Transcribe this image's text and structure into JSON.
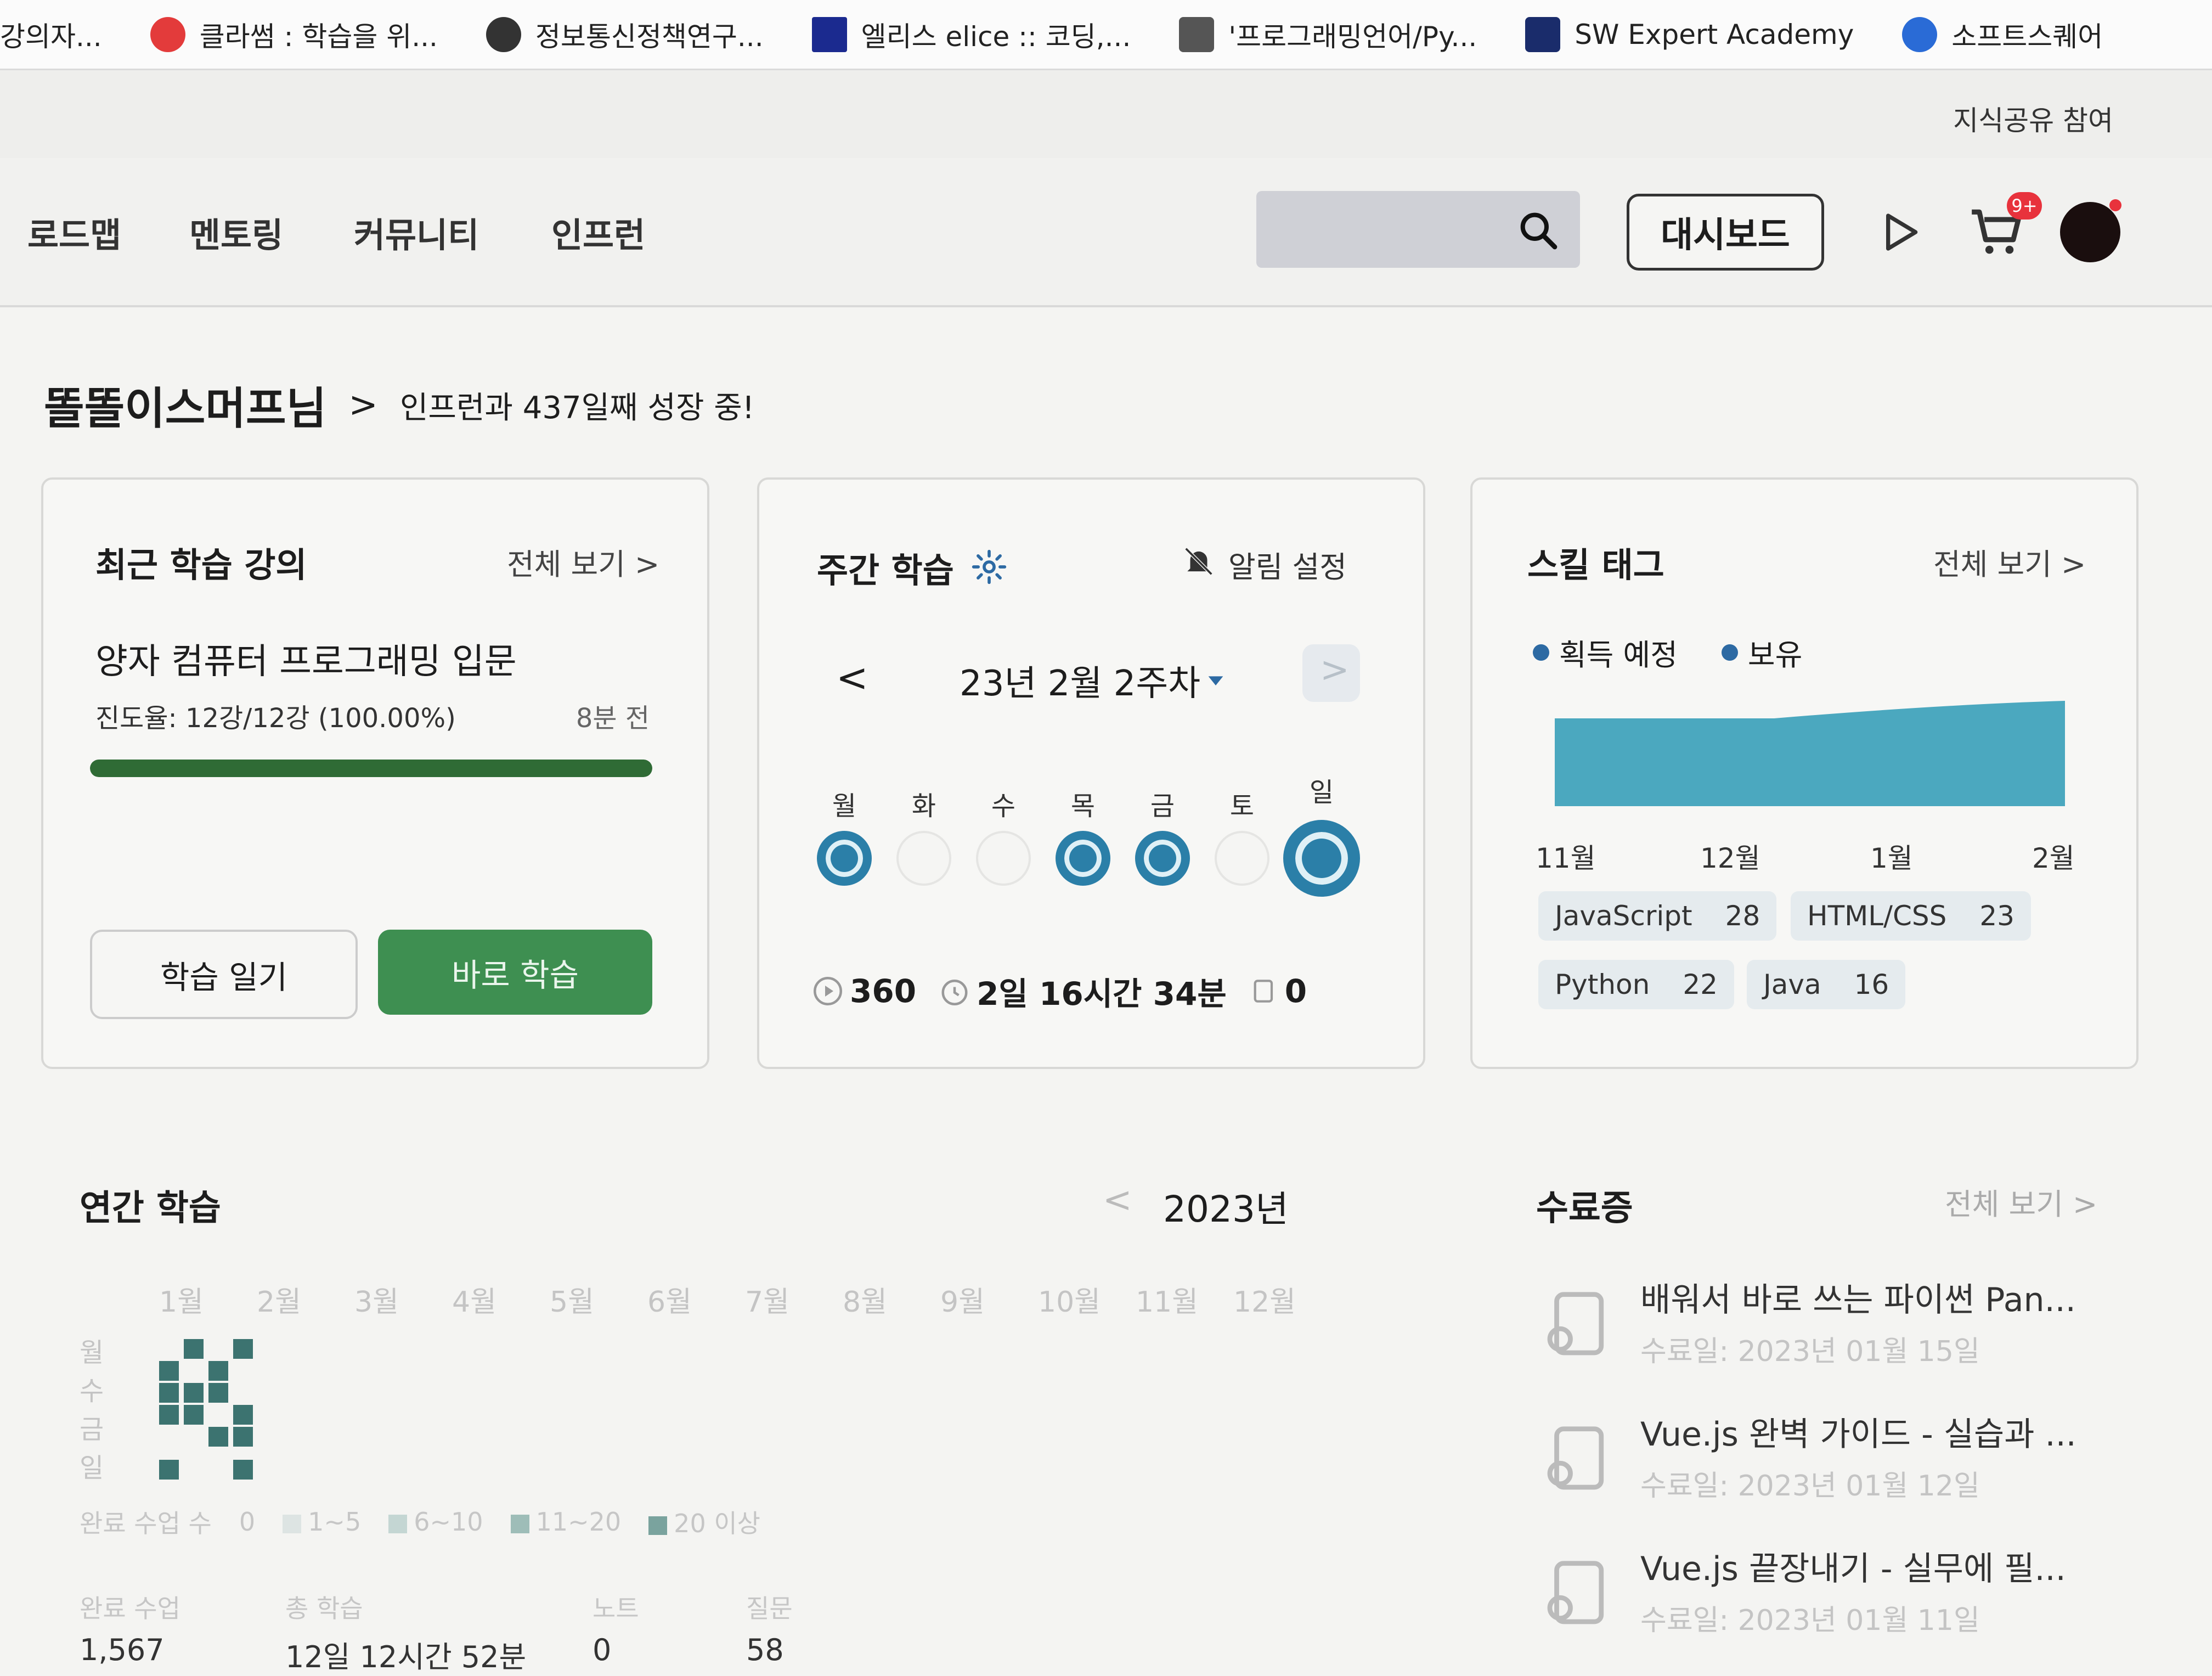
{
  "bookmarks": [
    {
      "label": "강의자...",
      "color": "#ffffff"
    },
    {
      "label": "클라썸 : 학습을 위...",
      "color": "#e33b3b"
    },
    {
      "label": "정보통신정책연구...",
      "color": "#333333"
    },
    {
      "label": "엘리스 elice :: 코딩,...",
      "color": "#1b2a8f"
    },
    {
      "label": "'프로그래밍언어/Py...",
      "color": "#555555"
    },
    {
      "label": "SW Expert Academy",
      "color": "#1a2c6b"
    },
    {
      "label": "소프트스퀘어",
      "color": "#2a6bd6"
    }
  ],
  "util": {
    "share_link": "지식공유 참여"
  },
  "nav": {
    "items": [
      "로드맵",
      "멘토링",
      "커뮤니티",
      "인프런"
    ],
    "dashboard": "대시보드",
    "cart_badge": "9+"
  },
  "greeting": {
    "name": "똘똘이스머프님",
    "chevron": ">",
    "message": "인프런과 437일째 성장 중!"
  },
  "recent": {
    "title": "최근 학습 강의",
    "more": "전체 보기 >",
    "course": "양자 컴퓨터 프로그래밍 입문",
    "progress_text": "진도율: 12강/12강 (100.00%)",
    "progress_fraction": 1.0,
    "time_ago": "8분 전",
    "btn_log": "학습 일기",
    "btn_go": "바로 학습",
    "accent": "#3e8f51"
  },
  "weekly": {
    "title": "주간 학습",
    "alarm": "알림 설정",
    "prev": "<",
    "next": ">",
    "week_label": "23년 2월 2주차",
    "days": [
      {
        "label": "월",
        "active": true
      },
      {
        "label": "화",
        "active": false
      },
      {
        "label": "수",
        "active": false
      },
      {
        "label": "목",
        "active": true
      },
      {
        "label": "금",
        "active": true
      },
      {
        "label": "토",
        "active": false
      },
      {
        "label": "일",
        "active": true,
        "today": true
      }
    ],
    "stats": {
      "lectures": "360",
      "time": "2일 16시간 34분",
      "notes": "0"
    }
  },
  "skills": {
    "title": "스킬 태그",
    "more": "전체 보기 >",
    "legend": [
      "획득 예정",
      "보유"
    ],
    "months": [
      "11월",
      "12월",
      "1월",
      "2월"
    ],
    "tags": [
      {
        "name": "JavaScript",
        "count": "28"
      },
      {
        "name": "HTML/CSS",
        "count": "23"
      },
      {
        "name": "Python",
        "count": "22"
      },
      {
        "name": "Java",
        "count": "16"
      }
    ],
    "area_color": "#4ba8bf"
  },
  "yearly": {
    "title": "연간 학습",
    "prev": "<",
    "year": "2023년",
    "months": [
      "1월",
      "2월",
      "3월",
      "4월",
      "5월",
      "6월",
      "7월",
      "8월",
      "9월",
      "10월",
      "11월",
      "12월"
    ],
    "days": [
      "월",
      "수",
      "금",
      "일"
    ],
    "legend_title": "완료 수업 수",
    "legend": [
      "0",
      "1~5",
      "6~10",
      "11~20",
      "20 이상"
    ],
    "stats": [
      {
        "label": "완료 수업",
        "value": "1,567"
      },
      {
        "label": "총 학습",
        "value": "12일 12시간 52분"
      },
      {
        "label": "노트",
        "value": "0"
      },
      {
        "label": "질문",
        "value": "58"
      }
    ]
  },
  "certs": {
    "title": "수료증",
    "more": "전체 보기 >",
    "items": [
      {
        "name": "배워서 바로 쓰는 파이썬 Pan...",
        "date": "수료일: 2023년 01월 15일"
      },
      {
        "name": "Vue.js 완벽 가이드 - 실습과 ...",
        "date": "수료일: 2023년 01월 12일"
      },
      {
        "name": "Vue.js 끝장내기 - 실무에 필...",
        "date": "수료일: 2023년 01월 11일"
      }
    ]
  }
}
